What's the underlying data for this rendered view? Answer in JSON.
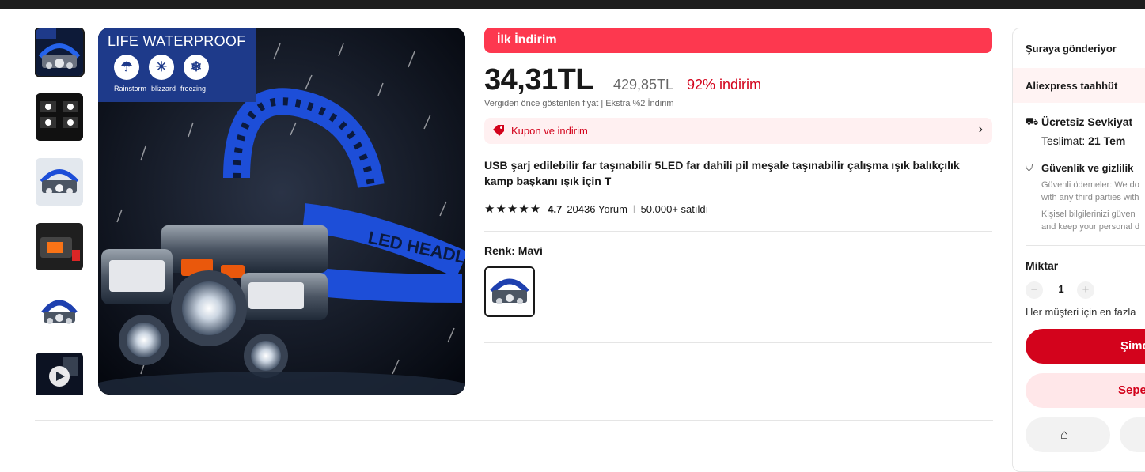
{
  "gallery": {
    "thumbnails": [
      {
        "name": "thumb-1",
        "selected": true
      },
      {
        "name": "thumb-2",
        "selected": false
      },
      {
        "name": "thumb-3",
        "selected": false
      },
      {
        "name": "thumb-4",
        "selected": false
      },
      {
        "name": "thumb-5",
        "selected": false
      },
      {
        "name": "thumb-6-video",
        "selected": false
      }
    ],
    "main_image": {
      "banner_title": "LIFE WATERPROOF",
      "banner_labels": [
        "Rainstorm",
        "blizzard",
        "freezing"
      ],
      "strap_text": "LED HEADLIGHT"
    }
  },
  "product": {
    "badge": "İlk İndirim",
    "price": "34,31TL",
    "old_price": "429,85TL",
    "discount": "92% indirim",
    "tax_note": "Vergiden önce gösterilen fiyat  |  Ekstra %2 İndirim",
    "coupon_label": "Kupon ve indirim",
    "title": "USB şarj edilebilir far taşınabilir 5LED far dahili pil meşale taşınabilir çalışma ışık balıkçılık kamp başkanı ışık için T",
    "rating": "4.7",
    "reviews": "20436 Yorum",
    "sold": "50.000+ satıldı",
    "color_label": "Renk: Mavi",
    "accent_color": "#fd384f",
    "primary_red": "#d3031c"
  },
  "panel": {
    "ship_to": "Şuraya gönderiyor",
    "commitment": "Aliexpress taahhüt",
    "free_shipping": "Ücretsiz Sevkiyat",
    "delivery_prefix": "Teslimat: ",
    "delivery_date": "21 Tem",
    "security_title": "Güvenlik ve gizlilik",
    "security_text_1": "Güvenli ödemeler: We do",
    "security_text_2": "with any third parties with",
    "security_text_3": "Kişisel bilgilerinizi güven",
    "security_text_4": "and keep your personal d",
    "quantity_label": "Miktar",
    "quantity_value": "1",
    "limit_note": "Her müşteri için en fazla",
    "buy_now": "Şimd",
    "add_to_cart": "Sepe"
  }
}
